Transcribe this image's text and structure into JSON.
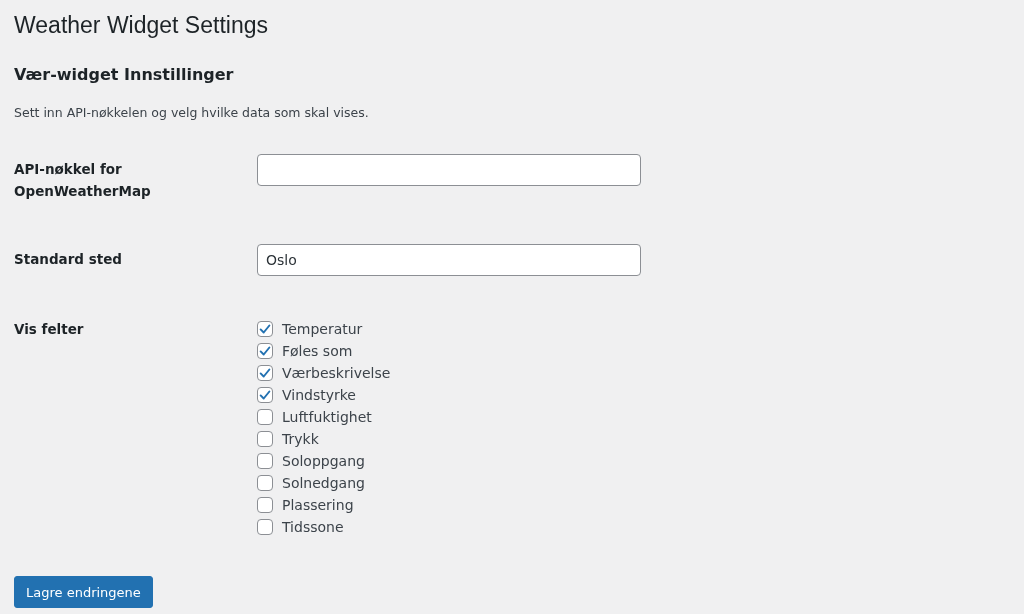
{
  "page_title": "Weather Widget Settings",
  "section": {
    "heading": "Vær-widget Innstillinger",
    "description": "Sett inn API-nøkkelen og velg hvilke data som skal vises."
  },
  "fields": [
    {
      "kind": "text",
      "label": "API-nøkkel for OpenWeatherMap"
    },
    {
      "kind": "text",
      "label": "Standard sted",
      "value": "Oslo"
    },
    {
      "kind": "checkboxes",
      "label": "Vis felter",
      "options": [
        {
          "label": "Temperatur",
          "checked": true
        },
        {
          "label": "Føles som",
          "checked": true
        },
        {
          "label": "Værbeskrivelse",
          "checked": true
        },
        {
          "label": "Vindstyrke",
          "checked": true
        },
        {
          "label": "Luftfuktighet",
          "checked": false
        },
        {
          "label": "Trykk",
          "checked": false
        },
        {
          "label": "Soloppgang",
          "checked": false
        },
        {
          "label": "Solnedgang",
          "checked": false
        },
        {
          "label": "Plassering",
          "checked": false
        },
        {
          "label": "Tidssone",
          "checked": false
        }
      ]
    }
  ],
  "save_button": "Lagre endringene"
}
